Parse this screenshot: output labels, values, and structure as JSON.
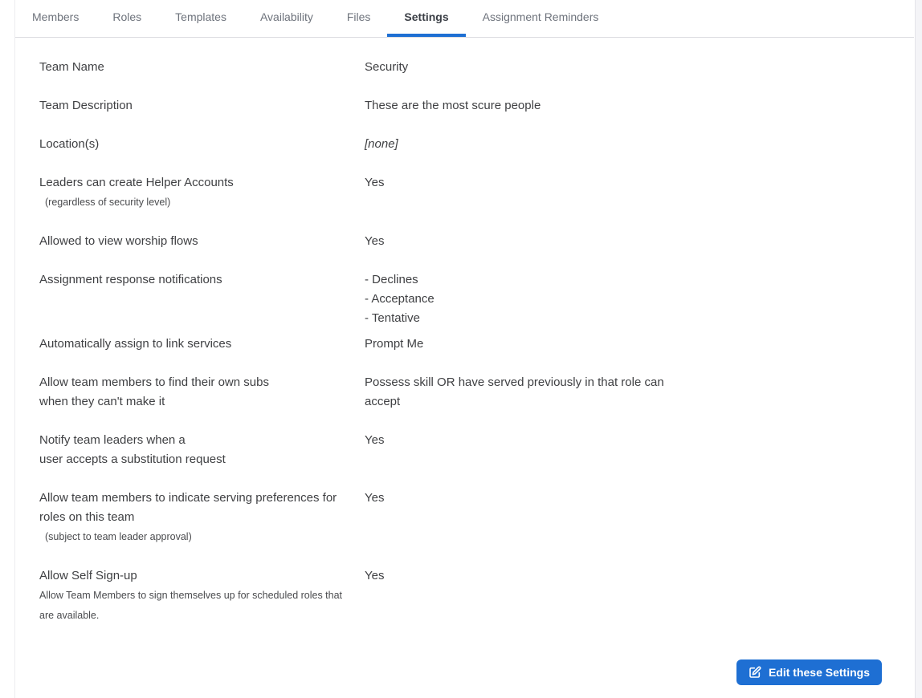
{
  "tabs": [
    {
      "label": "Members",
      "active": false
    },
    {
      "label": "Roles",
      "active": false
    },
    {
      "label": "Templates",
      "active": false
    },
    {
      "label": "Availability",
      "active": false
    },
    {
      "label": "Files",
      "active": false
    },
    {
      "label": "Settings",
      "active": true
    },
    {
      "label": "Assignment Reminders",
      "active": false
    }
  ],
  "settings": {
    "rows": [
      {
        "label_lines": [
          "Team Name"
        ],
        "values": [
          "Security"
        ]
      },
      {
        "label_lines": [
          "Team Description"
        ],
        "values": [
          "These are the most scure people"
        ]
      },
      {
        "label_lines": [
          "Location(s)"
        ],
        "values": [
          "[none]"
        ],
        "value_italic": true
      },
      {
        "label_lines": [
          "Leaders can create Helper Accounts"
        ],
        "note_lines": [
          "(regardless of security level)"
        ],
        "note_indent": true,
        "values": [
          "Yes"
        ]
      },
      {
        "label_lines": [
          "Allowed to view worship flows"
        ],
        "values": [
          "Yes"
        ]
      },
      {
        "label_lines": [
          "Assignment response notifications"
        ],
        "values": [
          "- Declines",
          "- Acceptance",
          "- Tentative"
        ]
      },
      {
        "label_lines": [
          "Automatically assign to link services"
        ],
        "values": [
          "Prompt Me"
        ]
      },
      {
        "label_lines": [
          "Allow team members to find their own subs",
          "when they can't make it"
        ],
        "values": [
          "Possess skill OR have served previously in that role can",
          "accept"
        ]
      },
      {
        "label_lines": [
          "Notify team leaders when a",
          "user accepts a substitution request"
        ],
        "values": [
          "Yes"
        ]
      },
      {
        "label_lines": [
          "Allow team members to indicate serving preferences for",
          "roles on this team"
        ],
        "note_lines": [
          "(subject to team leader approval)"
        ],
        "note_indent": true,
        "values": [
          "Yes"
        ]
      },
      {
        "label_lines": [
          "Allow Self Sign-up"
        ],
        "note_lines": [
          "Allow Team Members to sign themselves up for scheduled roles that",
          "are available."
        ],
        "note_indent": false,
        "values": [
          "Yes"
        ]
      }
    ]
  },
  "footer": {
    "edit_button_label": "Edit these Settings",
    "edit_button_icon": "pencil-square-icon"
  },
  "colors": {
    "accent_blue": "#1e6fd3",
    "tab_text": "#6e737c",
    "tab_active_text": "#3c4047",
    "body_text": "#3f4043",
    "border": "#dcdce0"
  }
}
